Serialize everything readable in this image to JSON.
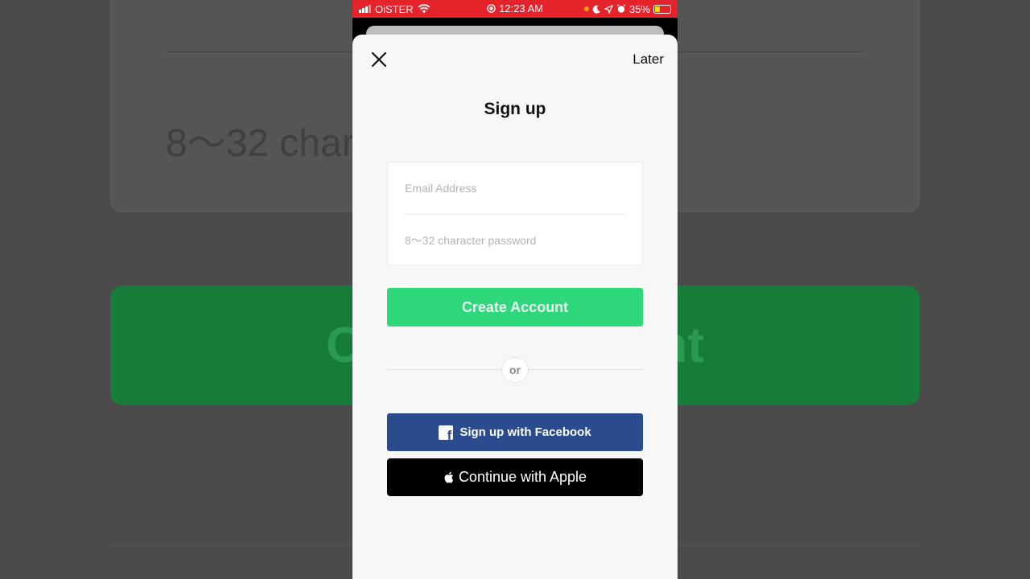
{
  "status_bar": {
    "carrier": "OiSTER",
    "time": "12:23 AM",
    "battery": "35%",
    "icons": [
      "signal-icon",
      "wifi-icon",
      "screen-record-icon",
      "moon-icon",
      "location-icon",
      "alarm-icon",
      "battery-icon"
    ]
  },
  "background": {
    "password_placeholder": "8～32 char",
    "button_fragment_left": "C",
    "button_fragment_right": "nt"
  },
  "header": {
    "close_icon": "close-icon",
    "later_label": "Later",
    "title": "Sign up"
  },
  "form": {
    "email_placeholder": "Email Address",
    "password_placeholder": "8～32 character password",
    "create_label": "Create Account"
  },
  "divider": {
    "label": "or"
  },
  "social": {
    "facebook_label": "Sign up with Facebook",
    "apple_label": "Continue with Apple"
  },
  "colors": {
    "status_bar": "#e5232a",
    "create_button": "#2ed87a",
    "facebook_button": "#2a4b8d",
    "apple_button": "#000000"
  }
}
